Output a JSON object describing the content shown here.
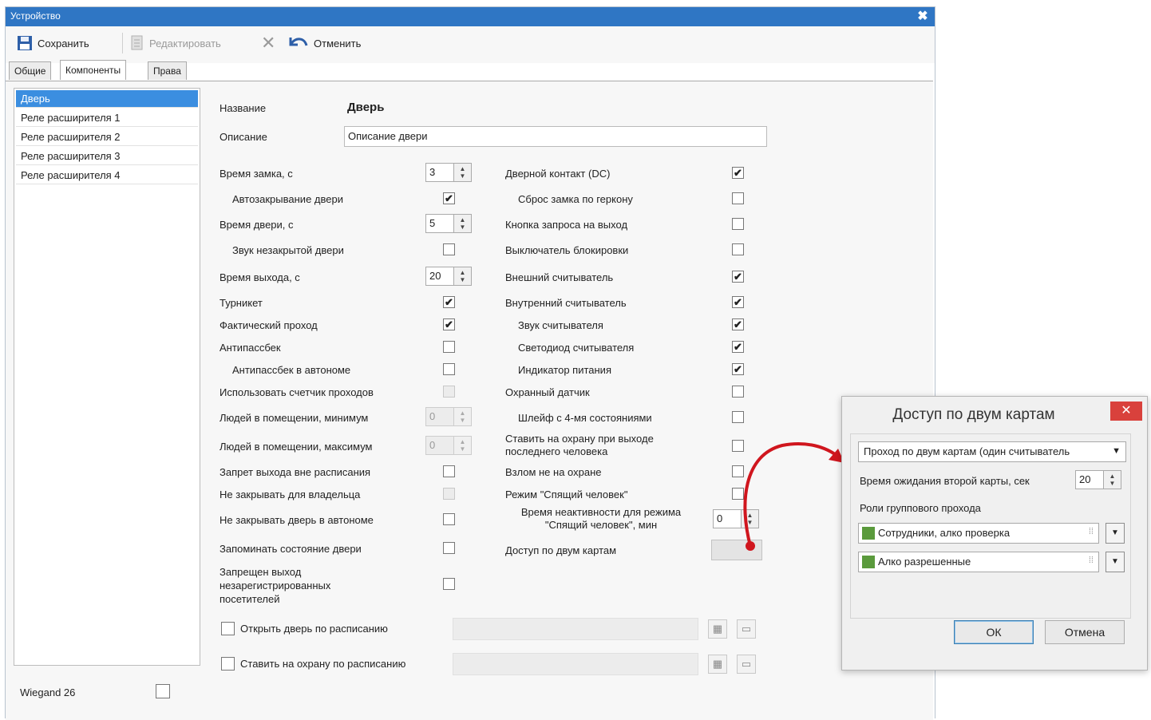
{
  "window": {
    "title": "Устройство",
    "close": "✖"
  },
  "toolbar": {
    "save": "Сохранить",
    "edit": "Редактировать",
    "cancel": "Отменить",
    "delete_glyph": "✕"
  },
  "tabs": [
    "Общие",
    "Компоненты",
    "Права"
  ],
  "device_list": [
    "Дверь",
    "Реле расширителя 1",
    "Реле расширителя 2",
    "Реле расширителя 3",
    "Реле расширителя 4"
  ],
  "form": {
    "name_label": "Название",
    "name_value": "Дверь",
    "desc_label": "Описание",
    "desc_value": "Описание двери",
    "left": {
      "lock_time": {
        "label": "Время замка, с",
        "value": "3"
      },
      "auto_close": {
        "label": "Автозакрывание двери",
        "checked": true
      },
      "door_time": {
        "label": "Время двери, с",
        "value": "5"
      },
      "unclosed_sound": {
        "label": "Звук незакрытой двери",
        "checked": false
      },
      "exit_time": {
        "label": "Время выхода, с",
        "value": "20"
      },
      "turnstile": {
        "label": "Турникет",
        "checked": true
      },
      "actual_pass": {
        "label": "Фактический проход",
        "checked": true
      },
      "antipassback": {
        "label": "Антипассбек",
        "checked": false
      },
      "antipassback_auto": {
        "label": "Антипассбек в автономе",
        "checked": false
      },
      "use_counter": {
        "label": "Использовать счетчик проходов",
        "checked": false
      },
      "people_min": {
        "label": "Людей в помещении, минимум",
        "value": "0"
      },
      "people_max": {
        "label": "Людей в помещении, максимум",
        "value": "0"
      },
      "exit_ban": {
        "label": "Запрет выхода вне расписания",
        "checked": false
      },
      "no_close_owner": {
        "label": "Не закрывать для владельца",
        "checked": false
      },
      "no_close_auto": {
        "label": "Не закрывать дверь в автономе",
        "checked": false
      },
      "remember_state": {
        "label": "Запоминать состояние двери",
        "checked": false
      },
      "unreg_exit": {
        "label": "Запрещен выход незарегистрированных посетителей",
        "checked": false
      }
    },
    "right": {
      "door_contact": {
        "label": "Дверной контакт (DC)",
        "checked": true
      },
      "reed_reset": {
        "label": "Сброс замка по геркону",
        "checked": false
      },
      "exit_button": {
        "label": "Кнопка запроса на выход",
        "checked": false
      },
      "block_switch": {
        "label": "Выключатель блокировки",
        "checked": false
      },
      "ext_reader": {
        "label": "Внешний считыватель",
        "checked": true
      },
      "int_reader": {
        "label": "Внутренний считыватель",
        "checked": true
      },
      "reader_sound": {
        "label": "Звук считывателя",
        "checked": true
      },
      "reader_led": {
        "label": "Светодиод считывателя",
        "checked": true
      },
      "power_ind": {
        "label": "Индикатор питания",
        "checked": true
      },
      "guard_sensor": {
        "label": "Охранный датчик",
        "checked": false
      },
      "loop4": {
        "label": "Шлейф с 4-мя состояниями",
        "checked": false
      },
      "arm_on_exit": {
        "label": "Ставить на охрану при выходе последнего человека",
        "checked": false
      },
      "break_unarmed": {
        "label": "Взлом не на охране",
        "checked": false
      },
      "sleeping_mode": {
        "label": "Режим \"Спящий человек\"",
        "checked": false
      },
      "inactivity_time": {
        "label": "Время неактивности для режима \"Спящий человек\", мин",
        "value": "0"
      },
      "two_cards": {
        "label": "Доступ по двум картам"
      }
    },
    "open_schedule": {
      "label": "Открыть дверь по расписанию",
      "checked": false
    },
    "arm_schedule": {
      "label": "Ставить на охрану по расписанию",
      "checked": false
    }
  },
  "wiegand": {
    "label": "Wiegand 26",
    "checked": false
  },
  "dialog": {
    "title": "Доступ по двум картам",
    "close": "✕",
    "mode": "Проход по двум картам (один считыватель",
    "wait_label": "Время ожидания второй карты, сек",
    "wait_value": "20",
    "roles_label": "Роли группового прохода",
    "role1": "Сотрудники, алко проверка",
    "role2": "Алко разрешенные",
    "ok": "ОК",
    "cancel": "Отмена"
  },
  "colors": {
    "titlebar": "#2f76c4",
    "selection": "#3b8ee0",
    "dialog_close": "#d9413c",
    "arrow": "#d0161e"
  }
}
